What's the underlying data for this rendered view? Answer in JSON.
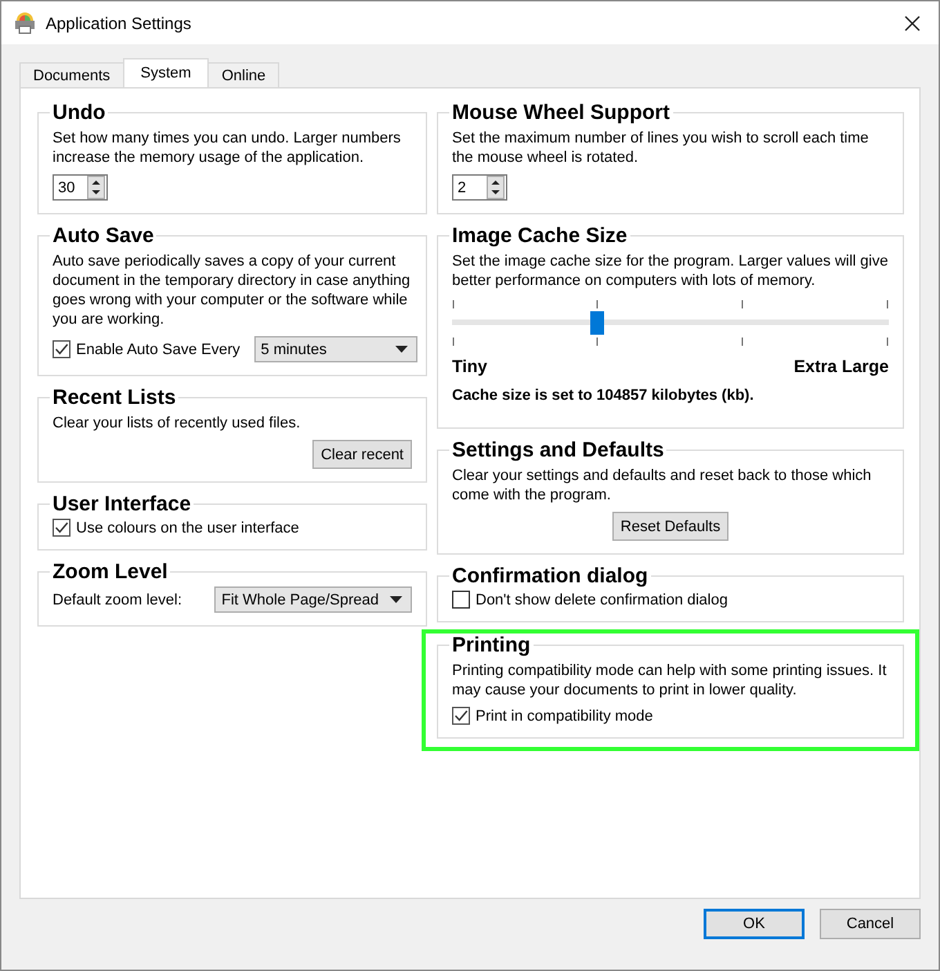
{
  "window": {
    "title": "Application Settings"
  },
  "tabs": [
    {
      "label": "Documents",
      "selected": false
    },
    {
      "label": "System",
      "selected": true
    },
    {
      "label": "Online",
      "selected": false
    }
  ],
  "columns": [
    {
      "groups": [
        {
          "title": "Undo",
          "highlighted": false,
          "description": "Set how many times you can undo. Larger numbers increase the memory usage of the application.",
          "rows": [
            {
              "items": [
                {
                  "kind": "spinner",
                  "value": "30"
                }
              ]
            }
          ]
        },
        {
          "title": "Auto Save",
          "highlighted": false,
          "description": "Auto save periodically saves a copy of your current document in the temporary directory in case anything goes wrong with your computer or the software while you are working.",
          "rows": [
            {
              "items": [
                {
                  "kind": "checkbox",
                  "label": "Enable Auto Save Every",
                  "checked": true
                },
                {
                  "kind": "dropdown",
                  "value": "5 minutes"
                }
              ]
            }
          ]
        },
        {
          "title": "Recent Lists",
          "highlighted": false,
          "description": "Clear your lists of recently used files.",
          "rows": [
            {
              "centered": false,
              "items": [
                {
                  "kind": "button",
                  "label": "Clear recent"
                }
              ]
            }
          ]
        },
        {
          "title": "User Interface",
          "highlighted": false,
          "rows": [
            {
              "items": [
                {
                  "kind": "checkbox",
                  "label": "Use colours on the user interface",
                  "checked": true
                }
              ]
            }
          ]
        },
        {
          "title": "Zoom Level",
          "highlighted": false,
          "rows": [
            {
              "items": [
                {
                  "kind": "label",
                  "text": "Default zoom level:"
                },
                {
                  "kind": "dropdown",
                  "value": "Fit Whole Page/Spread"
                }
              ]
            }
          ]
        }
      ]
    },
    {
      "groups": [
        {
          "title": "Mouse Wheel Support",
          "highlighted": false,
          "description": "Set the maximum number of lines you wish to scroll each time the mouse wheel is rotated.",
          "rows": [
            {
              "items": [
                {
                  "kind": "spinner",
                  "value": "2"
                }
              ]
            }
          ]
        },
        {
          "title": "Image Cache Size",
          "highlighted": false,
          "description": "Set the image cache size for the program. Larger values will give better performance on computers with lots of memory.",
          "rows": [
            {
              "items": [
                {
                  "kind": "slider",
                  "level": 0.333
                }
              ]
            },
            {
              "items": [
                {
                  "kind": "scale",
                  "min": "Tiny",
                  "max": "Extra Large"
                }
              ]
            },
            {
              "items": [
                {
                  "kind": "note",
                  "text": "Cache size is set to 104857 kilobytes (kb)."
                }
              ]
            }
          ]
        },
        {
          "title": "Settings and Defaults",
          "highlighted": false,
          "description": "Clear your settings and defaults and reset back to those which come with the program.",
          "rows": [
            {
              "centered": true,
              "items": [
                {
                  "kind": "button",
                  "label": "Reset Defaults"
                }
              ]
            }
          ]
        },
        {
          "title": "Confirmation dialog",
          "highlighted": false,
          "rows": [
            {
              "items": [
                {
                  "kind": "checkbox",
                  "label": "Don't show delete confirmation dialog",
                  "checked": false
                }
              ]
            }
          ]
        },
        {
          "title": "Printing",
          "highlighted": true,
          "description": "Printing compatibility mode can help with some printing issues. It may cause your documents to print in lower quality.",
          "rows": [
            {
              "items": [
                {
                  "kind": "checkbox",
                  "label": "Print in compatibility mode",
                  "checked": true
                }
              ]
            }
          ]
        }
      ]
    }
  ],
  "buttons": [
    {
      "label": "OK",
      "default": true
    },
    {
      "label": "Cancel",
      "default": false
    }
  ]
}
